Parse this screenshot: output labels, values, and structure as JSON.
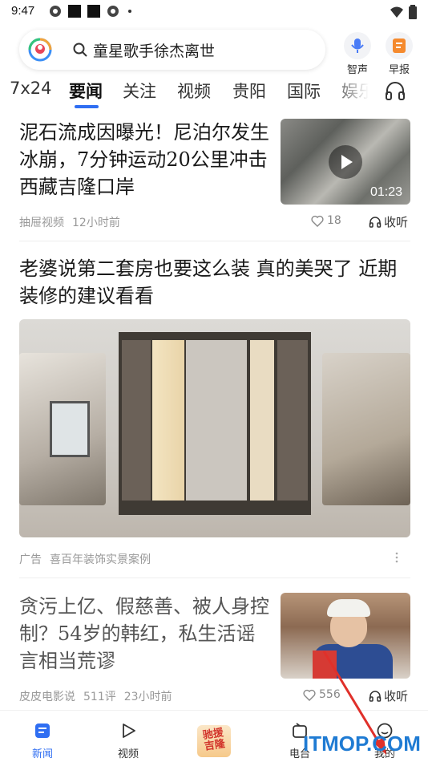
{
  "status_bar": {
    "time": "9:47"
  },
  "search": {
    "query": "童星歌手徐杰离世"
  },
  "top_buttons": [
    {
      "label": "智声",
      "icon": "microphone-icon"
    },
    {
      "label": "早报",
      "icon": "morning-news-icon"
    }
  ],
  "tabs": [
    "7x24",
    "要闻",
    "关注",
    "视频",
    "贵阳",
    "国际",
    "娱乐"
  ],
  "active_tab": "要闻",
  "feed": [
    {
      "title": "泥石流成因曝光！尼泊尔发生冰崩，7分钟运动20公里冲击西藏吉隆口岸",
      "source": "抽屉视频",
      "time": "12小时前",
      "likes": "18",
      "listen": "收听",
      "duration": "01:23"
    },
    {
      "title": "老婆说第二套房也要这么装 真的美哭了 近期装修的建议看看",
      "ad_label": "广告",
      "source": "喜百年装饰实景案例"
    },
    {
      "title": "贪污上亿、假慈善、被人身控制？54岁的韩红，私生活谣言相当荒谬",
      "source": "皮皮电影说",
      "comments": "511评",
      "time": "23小时前",
      "likes": "556",
      "listen": "收听"
    }
  ],
  "bottom_nav": [
    {
      "label": "新闻",
      "icon": "news-icon",
      "active": true
    },
    {
      "label": "视频",
      "icon": "video-play-icon",
      "active": false
    },
    {
      "label": "驰援吉隆",
      "icon": "campaign-badge-icon",
      "active": false
    },
    {
      "label": "电台",
      "icon": "radio-icon",
      "active": false
    },
    {
      "label": "我的",
      "icon": "profile-icon",
      "active": false
    }
  ],
  "watermark": "ITMOP.COM",
  "colors": {
    "accent": "#2f6ef2",
    "arrow": "#e0302a",
    "watermark": "#1f7bd3"
  }
}
